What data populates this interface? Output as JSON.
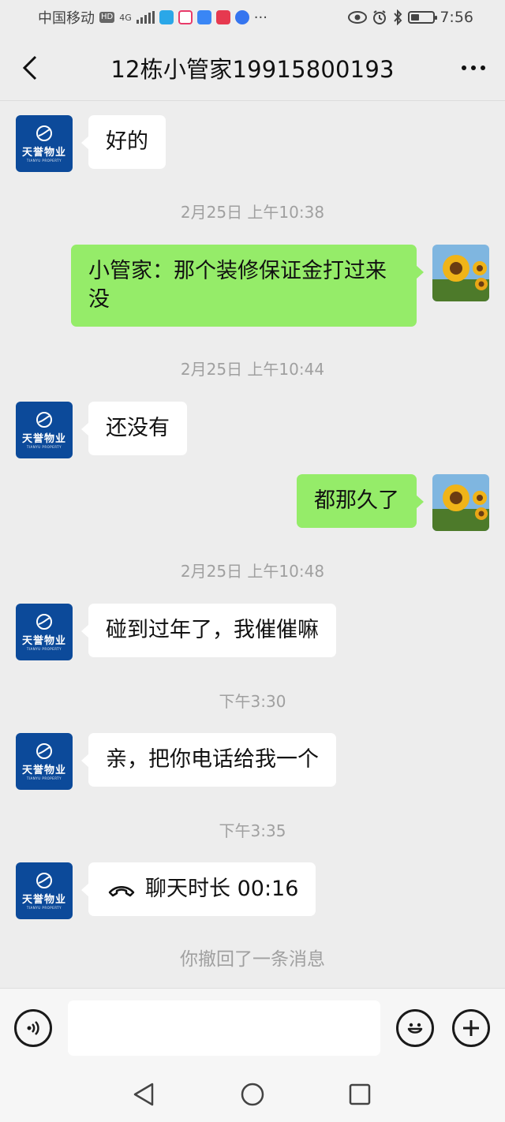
{
  "status_bar": {
    "carrier": "中国移动",
    "hd": "HD",
    "network": "4G",
    "time": "7:56",
    "more": "···",
    "battery_level": 0.4
  },
  "header": {
    "title": "12栋小管家19915800193"
  },
  "contact_avatar": {
    "brand": "天誉物业",
    "brand_sub": "TIANYU PROPERTY"
  },
  "messages": [
    {
      "type": "in",
      "text": "好的"
    },
    {
      "type": "time",
      "text": "2月25日 上午10:38"
    },
    {
      "type": "out",
      "text": "小管家：那个装修保证金打过来没"
    },
    {
      "type": "time",
      "text": "2月25日 上午10:44"
    },
    {
      "type": "in",
      "text": "还没有"
    },
    {
      "type": "out",
      "text": "都那久了"
    },
    {
      "type": "time",
      "text": "2月25日 上午10:48"
    },
    {
      "type": "in",
      "text": "碰到过年了，我催催嘛"
    },
    {
      "type": "time",
      "text": "下午3:30"
    },
    {
      "type": "in",
      "text": "亲，把你电话给我一个"
    },
    {
      "type": "time",
      "text": "下午3:35"
    },
    {
      "type": "in",
      "text": "聊天时长 00:16"
    },
    {
      "type": "system",
      "text": "你撤回了一条消息"
    }
  ],
  "input": {
    "voice_icon": "voice-icon",
    "emoji_icon": "emoji-icon",
    "add_icon": "plus-icon"
  },
  "colors": {
    "background": "#ededed",
    "bubble_in": "#ffffff",
    "bubble_out": "#95ec69",
    "avatar_brand": "#0c4a9a"
  }
}
